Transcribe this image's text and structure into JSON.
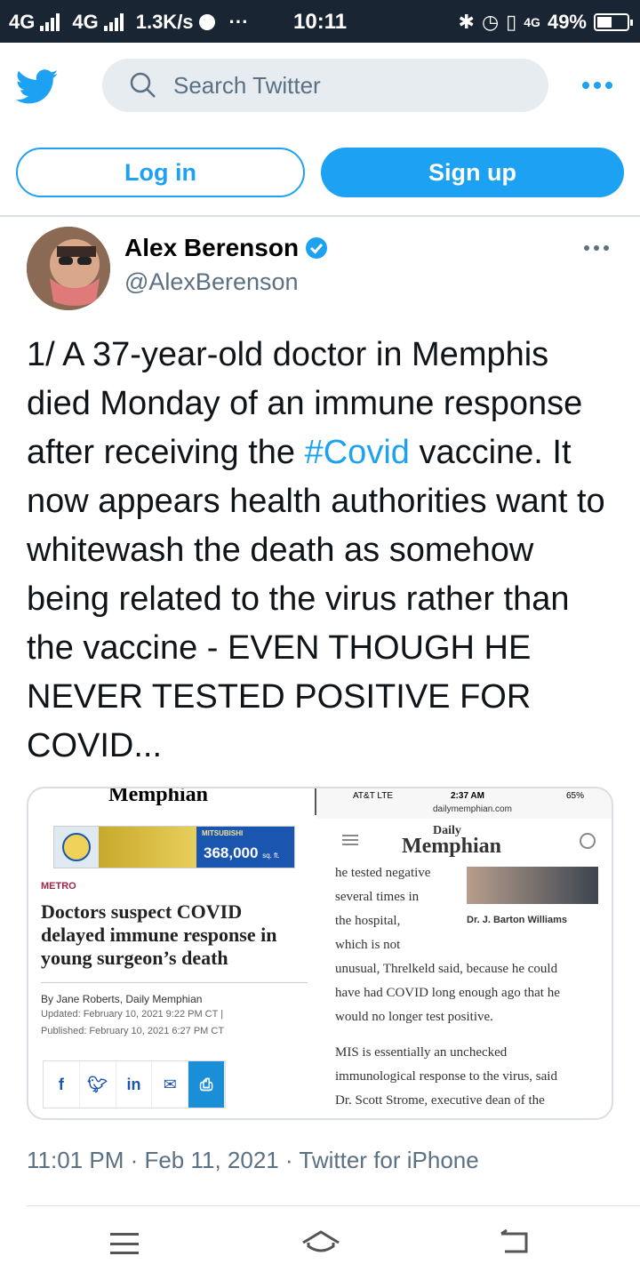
{
  "status_bar": {
    "network1": "4G",
    "network2": "4G",
    "speed": "1.3K/s",
    "dots": "···",
    "time": "10:11",
    "network_small": "4G",
    "battery": "49%"
  },
  "header": {
    "search_placeholder": "Search Twitter",
    "login_label": "Log in",
    "signup_label": "Sign up",
    "brand_color": "#1da1f2"
  },
  "tweet": {
    "author_name": "Alex Berenson",
    "author_handle": "@AlexBerenson",
    "text_before": "1/ A 37-year-old doctor in Memphis died Monday of an immune response after receiving the ",
    "hashtag": "#Covid",
    "text_after": " vaccine. It now appears health authorities want to whitewash the death as somehow being related to the virus rather than the vaccine - EVEN THOUGH HE NEVER TESTED POSITIVE FOR COVID...",
    "timestamp": "11:01 PM · Feb 11, 2021 · Twitter for iPhone"
  },
  "media": {
    "left": {
      "masthead": "Memphian",
      "ad_brand": "MITSUBISHI",
      "ad_number": "368,000",
      "ad_unit": "sq. ft.",
      "section": "METRO",
      "headline": "Doctors suspect COVID delayed immune response in young surgeon’s death",
      "byline": "By Jane Roberts, Daily Memphian",
      "updated": "Updated: February 10, 2021 9:22 PM CT |",
      "published": "Published: February 10, 2021 6:27 PM CT"
    },
    "right": {
      "carrier": "AT&T  LTE",
      "phone_time": "2:37 AM",
      "url": "dailymemphian.com",
      "phone_battery": "65%",
      "masthead_small": "Daily",
      "masthead": "Memphian",
      "photo_caption": "Dr. J. Barton Williams",
      "lines": [
        "he tested negative",
        "several times in",
        "the hospital,",
        "which is not",
        "unusual, Threlkeld said, because he could",
        "have had COVID long enough ago that he",
        "would no longer test positive.",
        "MIS is essentially an unchecked",
        "immunological response to the virus, said",
        "Dr. Scott Strome, executive dean of the"
      ]
    }
  }
}
